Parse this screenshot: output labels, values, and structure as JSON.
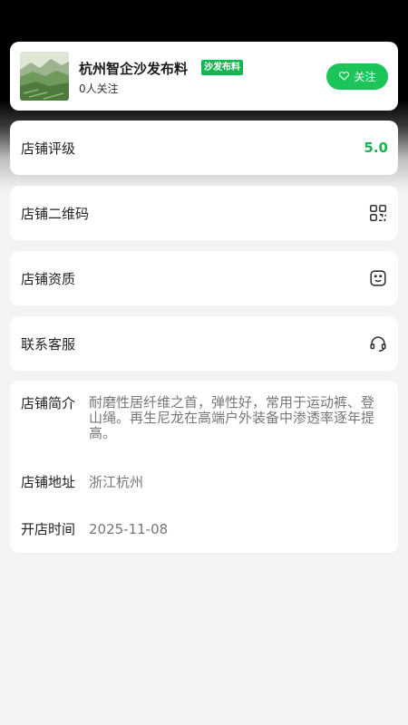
{
  "store": {
    "name": "杭州智企沙发布料",
    "tag": "沙发布料",
    "followers": "0人关注",
    "follow_label": "关注",
    "follow_icon": "heart-outline-icon"
  },
  "rows": {
    "rating": {
      "label": "店铺评级",
      "value": "5.0"
    },
    "qrcode": {
      "label": "店铺二维码",
      "icon": "qrcode-icon"
    },
    "qualification": {
      "label": "店铺资质",
      "icon": "certificate-icon"
    },
    "contact": {
      "label": "联系客服",
      "icon": "headset-icon"
    }
  },
  "info": {
    "intro_label": "店铺简介",
    "intro_value": "耐磨性居纤维之首，弹性好，常用于运动裤、登山绳。再生尼龙在高端户外装备中渗透率逐年提高。",
    "address_label": "店铺地址",
    "address_value": "浙江杭州",
    "opened_label": "开店时间",
    "opened_value": "2025-11-08"
  },
  "colors": {
    "accent_green": "#1cc55a",
    "rating_green": "#16b552"
  }
}
